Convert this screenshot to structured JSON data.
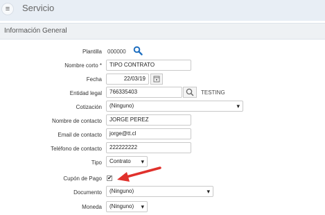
{
  "header": {
    "menu_icon": "hamburger-icon",
    "title": "Servicio"
  },
  "section": {
    "title": "Información General"
  },
  "form": {
    "plantilla": {
      "label": "Plantilla",
      "value": "000000",
      "icon": "search-icon"
    },
    "nombre_corto": {
      "label": "Nombre corto *",
      "value": "TIPO CONTRATO"
    },
    "fecha": {
      "label": "Fecha",
      "value": "22/03/19",
      "icon": "calendar-icon"
    },
    "entidad_legal": {
      "label": "Entidad legal",
      "value": "766335403",
      "icon": "search-icon",
      "extra": "TESTING"
    },
    "cotizacion": {
      "label": "Cotización",
      "value": "(Ninguno)"
    },
    "nombre_contacto": {
      "label": "Nombre de contacto",
      "value": "JORGE PEREZ"
    },
    "email_contacto": {
      "label": "Email de contacto",
      "value": "jorge@tt.cl"
    },
    "telefono_contacto": {
      "label": "Teléfono de contacto",
      "value": "222222222"
    },
    "tipo": {
      "label": "Tipo",
      "value": "Contrato"
    },
    "cupon_pago": {
      "label": "Cupón de Pago",
      "checked": "✔"
    },
    "documento": {
      "label": "Documento",
      "value": "(Ninguno)"
    },
    "moneda": {
      "label": "Moneda",
      "value": "(Ninguno)"
    }
  },
  "annotation": {
    "icon": "red-arrow-icon",
    "color": "#e0312c"
  }
}
